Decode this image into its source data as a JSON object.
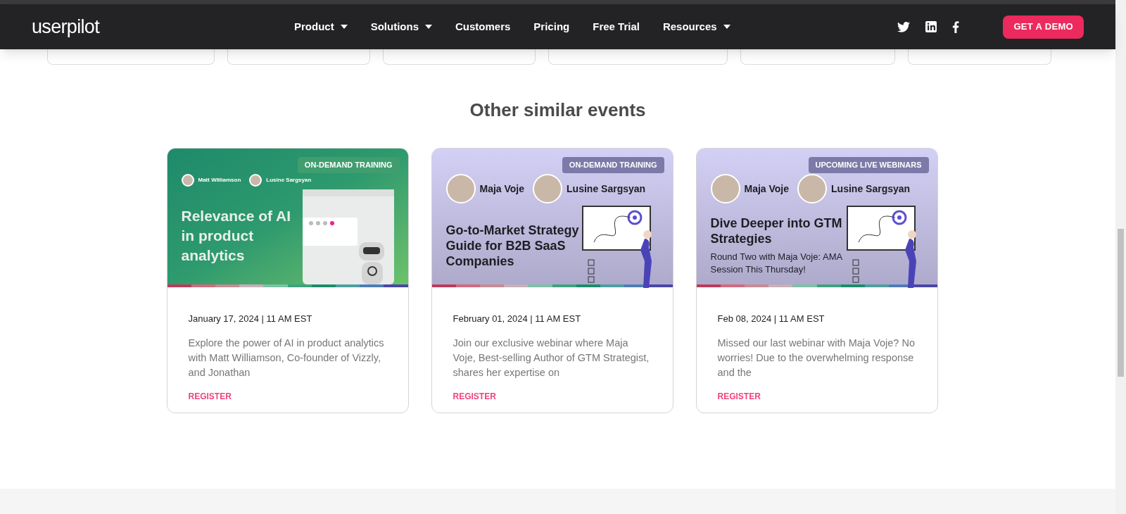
{
  "nav": {
    "logo": "userpilot",
    "items": [
      {
        "label": "Product",
        "dropdown": true
      },
      {
        "label": "Solutions",
        "dropdown": true
      },
      {
        "label": "Customers",
        "dropdown": false
      },
      {
        "label": "Pricing",
        "dropdown": false
      },
      {
        "label": "Free Trial",
        "dropdown": false
      },
      {
        "label": "Resources",
        "dropdown": true
      }
    ],
    "social": [
      {
        "kind": "twitter"
      },
      {
        "kind": "linkedin"
      },
      {
        "kind": "facebook"
      }
    ],
    "cta": "GET A DEMO"
  },
  "section_title": "Other similar events",
  "events": [
    {
      "kind": "robot",
      "badge": "ON-DEMAND TRAINING",
      "speakers": [
        {
          "name": "Matt Williamson"
        },
        {
          "name": "Lusine Sargsyan"
        }
      ],
      "headline": "Relevance of AI in product analytics",
      "date": "January 17, 2024 | 11 AM EST",
      "description": "Explore the power of AI in product analytics with Matt Williamson, Co-founder of Vizzly, and Jonathan",
      "link": "REGISTER"
    },
    {
      "kind": "board",
      "badge": "ON-DEMAND TRAINING",
      "speakers": [
        {
          "name": "Maja Voje"
        },
        {
          "name": "Lusine Sargsyan"
        }
      ],
      "headline": "Go-to-Market Strategy Guide for B2B SaaS Companies",
      "date": "February 01, 2024 | 11 AM EST",
      "description": "Join our exclusive webinar where Maja Voje, Best-selling Author of GTM Strategist, shares her expertise on",
      "link": "REGISTER"
    },
    {
      "kind": "board",
      "badge": "UPCOMING LIVE WEBINARS",
      "speakers": [
        {
          "name": "Maja Voje"
        },
        {
          "name": "Lusine Sargsyan"
        }
      ],
      "headline": "Dive Deeper into GTM Strategies",
      "subheadline": "Round Two with Maja Voje: AMA Session This Thursday!",
      "date": "Feb 08, 2024 | 11 AM EST",
      "description": "Missed our last webinar with Maja Voje? No worries! Due to the overwhelming response and the",
      "link": "REGISTER"
    }
  ]
}
